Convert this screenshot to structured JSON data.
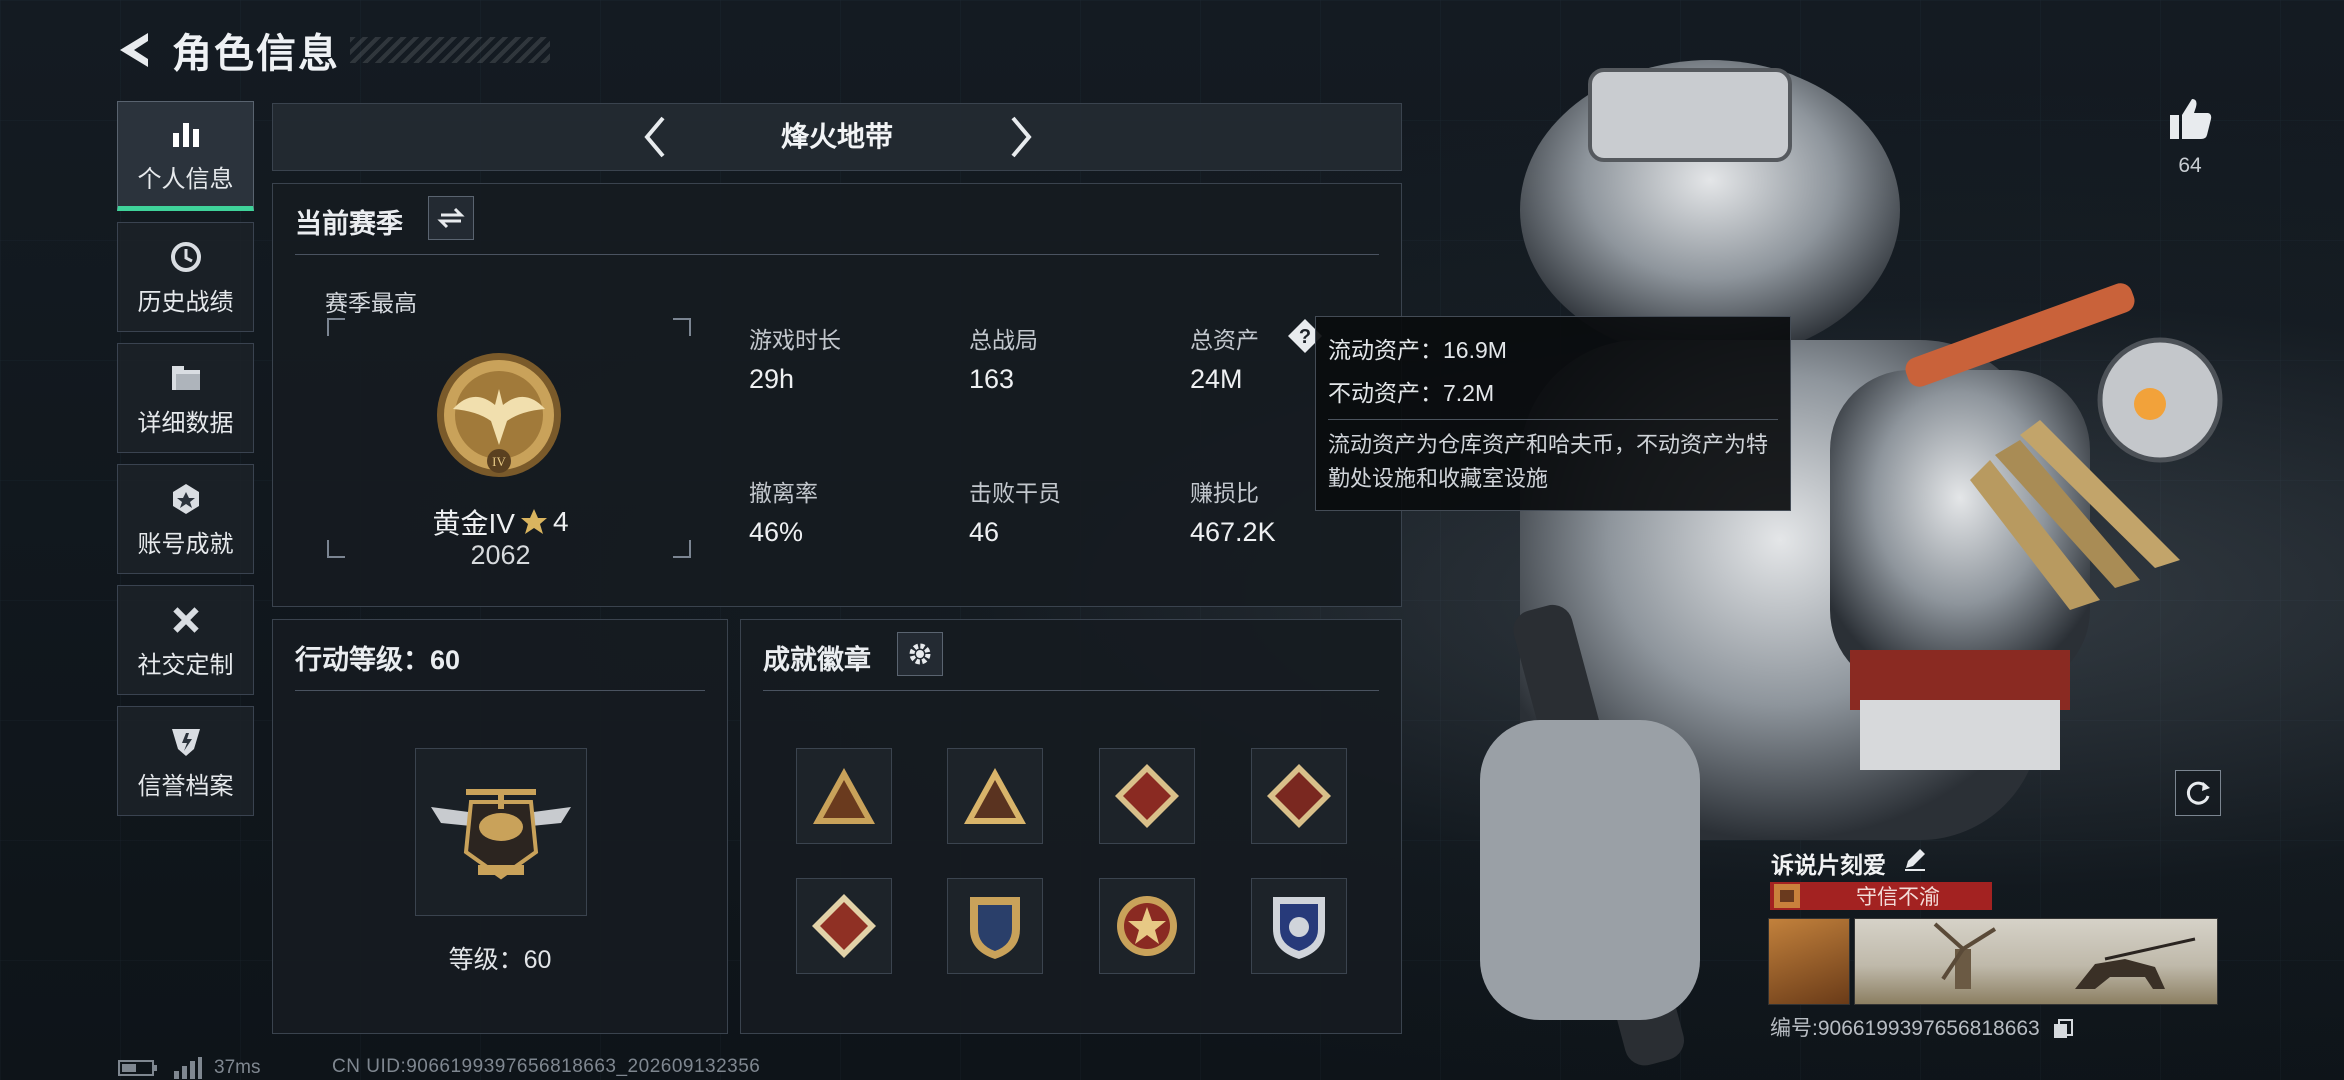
{
  "header": {
    "title": "角色信息"
  },
  "sidebar": {
    "items": [
      {
        "label": "个人信息",
        "icon": "bar-chart-icon",
        "active": true
      },
      {
        "label": "历史战绩",
        "icon": "history-clock-icon"
      },
      {
        "label": "详细数据",
        "icon": "folder-icon"
      },
      {
        "label": "账号成就",
        "icon": "achievement-icon"
      },
      {
        "label": "社交定制",
        "icon": "tools-icon"
      },
      {
        "label": "信誉档案",
        "icon": "shield-badge-icon"
      }
    ]
  },
  "season_selector": {
    "name": "烽火地带"
  },
  "current_season": {
    "title": "当前赛季",
    "highest_label": "赛季最高",
    "rank_name": "黄金IV",
    "rank_stars": "4",
    "rank_score": "2062",
    "stats": [
      {
        "label": "游戏时长",
        "value": "29h"
      },
      {
        "label": "总战局",
        "value": "163"
      },
      {
        "label": "总资产",
        "value": "24M"
      },
      {
        "label": "撤离率",
        "value": "46%"
      },
      {
        "label": "击败干员",
        "value": "46"
      },
      {
        "label": "赚损比",
        "value": "467.2K"
      }
    ]
  },
  "tooltip": {
    "liquid": "流动资产：16.9M",
    "fixed": "不动资产：7.2M",
    "note": "流动资产为仓库资产和哈夫币，不动资产为特勤处设施和收藏室设施"
  },
  "action_level": {
    "title": "行动等级：60",
    "level_text": "等级：60"
  },
  "achievement_badges": {
    "title": "成就徽章"
  },
  "like": {
    "count": "64"
  },
  "card": {
    "name": "诉说片刻爱",
    "motto": "守信不渝"
  },
  "serial": "编号:9066199397656818663",
  "status": {
    "ping": "37ms",
    "uid": "CN UID:9066199397656818663_202609132356"
  },
  "colors": {
    "accent": "#3fd39a",
    "motto_red": "#a32221",
    "gold": "#c9a25a"
  }
}
